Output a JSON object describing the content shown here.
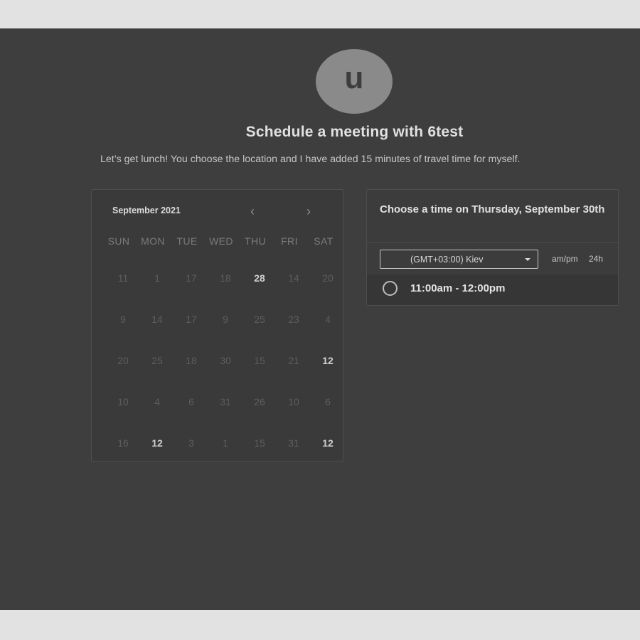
{
  "header": {
    "avatar_letter": "u",
    "title": "Schedule a meeting with 6test",
    "subtitle": "Let’s get lunch! You choose the location and I have added 15 minutes of travel time for myself."
  },
  "calendar": {
    "month_label": "September 2021",
    "prev_glyph": "‹",
    "next_glyph": "›",
    "weekdays": [
      "SUN",
      "MON",
      "TUE",
      "WED",
      "THU",
      "FRI",
      "SAT"
    ],
    "days": [
      {
        "label": "11",
        "active": false
      },
      {
        "label": "1",
        "active": false
      },
      {
        "label": "17",
        "active": false
      },
      {
        "label": "18",
        "active": false
      },
      {
        "label": "28",
        "active": true
      },
      {
        "label": "14",
        "active": false
      },
      {
        "label": "20",
        "active": false
      },
      {
        "label": "9",
        "active": false
      },
      {
        "label": "14",
        "active": false
      },
      {
        "label": "17",
        "active": false
      },
      {
        "label": "9",
        "active": false
      },
      {
        "label": "25",
        "active": false
      },
      {
        "label": "23",
        "active": false
      },
      {
        "label": "4",
        "active": false
      },
      {
        "label": "20",
        "active": false
      },
      {
        "label": "25",
        "active": false
      },
      {
        "label": "18",
        "active": false
      },
      {
        "label": "30",
        "active": false
      },
      {
        "label": "15",
        "active": false
      },
      {
        "label": "21",
        "active": false
      },
      {
        "label": "12",
        "active": true
      },
      {
        "label": "10",
        "active": false
      },
      {
        "label": "4",
        "active": false
      },
      {
        "label": "6",
        "active": false
      },
      {
        "label": "31",
        "active": false
      },
      {
        "label": "26",
        "active": false
      },
      {
        "label": "10",
        "active": false
      },
      {
        "label": "6",
        "active": false
      },
      {
        "label": "16",
        "active": false
      },
      {
        "label": "12",
        "active": true
      },
      {
        "label": "3",
        "active": false
      },
      {
        "label": "1",
        "active": false
      },
      {
        "label": "15",
        "active": false
      },
      {
        "label": "31",
        "active": false
      },
      {
        "label": "12",
        "active": true
      }
    ]
  },
  "times": {
    "title": "Choose a time on Thursday, September 30th",
    "timezone_value": "(GMT+03:00) Kiev",
    "format_ampm": "am/pm",
    "format_24h": "24h",
    "slots": [
      {
        "label": "11:00am - 12:00pm"
      }
    ]
  },
  "colors": {
    "page_frame": "#e2e2e2",
    "background": "#3e3e3e",
    "avatar": "#8a8a8a",
    "text_primary": "#e1e1e1",
    "text_muted": "#5d5d5d"
  }
}
